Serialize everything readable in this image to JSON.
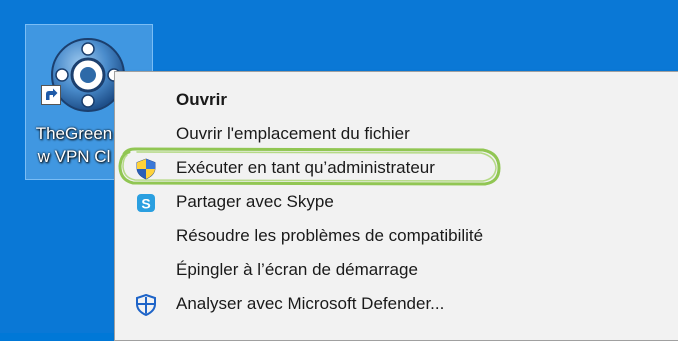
{
  "desktop": {
    "shortcut": {
      "label_line1": "TheGreen",
      "label_line2": "w VPN Cl"
    }
  },
  "context_menu": {
    "items": [
      {
        "label": "Ouvrir",
        "icon": null,
        "bold": true
      },
      {
        "label": "Ouvrir l'emplacement du fichier",
        "icon": null
      },
      {
        "label": "Exécuter en tant qu’administrateur",
        "icon": "uac-shield-icon",
        "highlighted": true
      },
      {
        "label": "Partager avec Skype",
        "icon": "skype-icon"
      },
      {
        "label": "Résoudre les problèmes de compatibilité",
        "icon": null
      },
      {
        "label": "Épingler à l’écran de démarrage",
        "icon": null
      },
      {
        "label": "Analyser avec Microsoft Defender...",
        "icon": "defender-icon"
      }
    ]
  },
  "colors": {
    "desktop_background": "#0a78d6",
    "menu_background": "#f2f2f2",
    "highlight_stroke": "#8bc34a"
  }
}
